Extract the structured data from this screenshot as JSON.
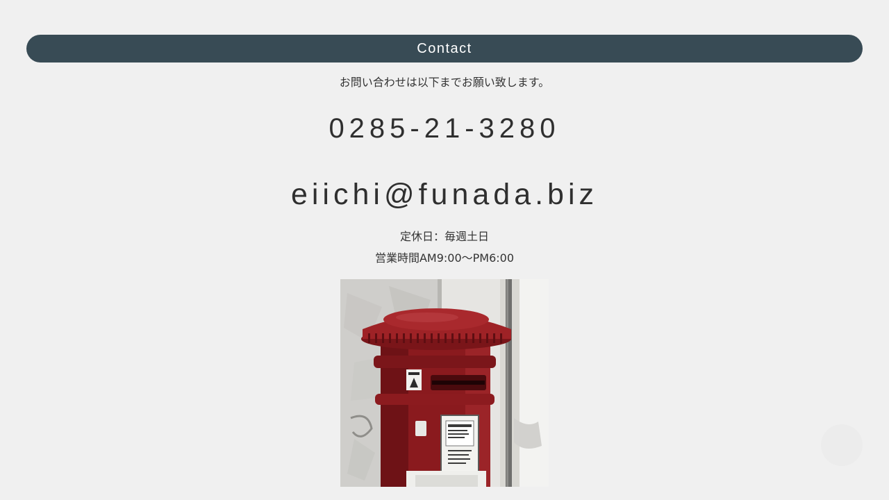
{
  "contact": {
    "title": "Contact",
    "intro": "お問い合わせは以下までお願い致します。",
    "phone": "0285-21-3280",
    "email": "eiichi@funada.biz",
    "holiday": "定休日：毎週土日",
    "hours": "営業時間AM9:00〜PM6:00"
  },
  "colors": {
    "header_bg": "#384b55",
    "page_bg": "#f0f0f0",
    "text": "#333333",
    "postbox_red": "#8e1b1f"
  },
  "image": {
    "subject": "red-postbox-photo"
  }
}
